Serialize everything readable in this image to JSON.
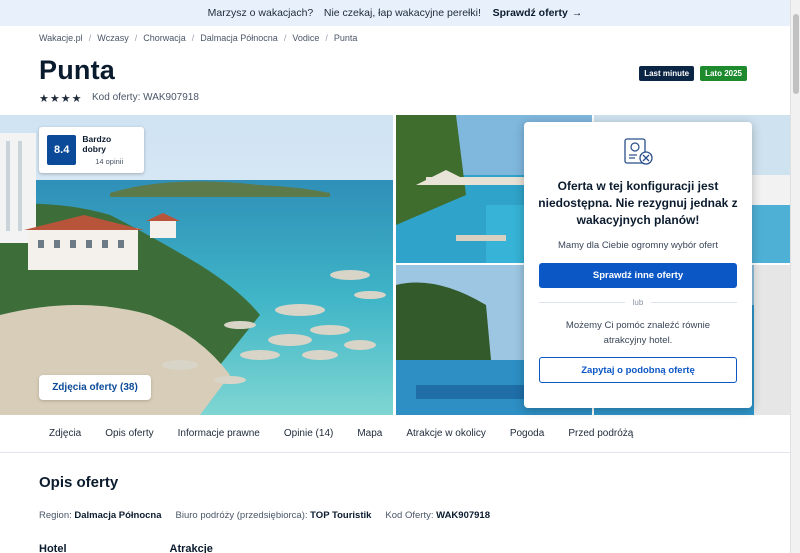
{
  "promo": {
    "text": "Marzysz o wakacjach?⠀ Nie czekaj, łap wakacyjne perełki!⠀",
    "cta": "Sprawdź oferty",
    "arrow": "→"
  },
  "breadcrumbs": [
    "Wakacje.pl",
    "Wczasy",
    "Chorwacja",
    "Dalmacja Północna",
    "Vodice",
    "Punta"
  ],
  "breadcrumb_sep": "/",
  "hotel": {
    "name": "Punta",
    "stars": 4,
    "code_label": "Kod oferty: WAK907918"
  },
  "badges": {
    "last_minute": "Last minute",
    "season": "Lato 2025"
  },
  "rating": {
    "score": "8.4",
    "label": "Bardzo dobry",
    "count": "14 opinii"
  },
  "gallery": {
    "photos_button": "Zdjęcia oferty (38)"
  },
  "modal": {
    "title": "Oferta w tej konfiguracji jest niedostępna. Nie rezygnuj jednak z wakacyjnych planów!",
    "subtitle": "Mamy dla Ciebie ogromny wybór ofert",
    "primary_button": "Sprawdź inne oferty",
    "or_label": "lub",
    "help_text": "Możemy Ci pomóc znaleźć równie atrakcyjny hotel.",
    "secondary_button": "Zapytaj o podobną ofertę"
  },
  "tabs": [
    "Zdjęcia",
    "Opis oferty",
    "Informacje prawne",
    "Opinie (14)",
    "Mapa",
    "Atrakcje w okolicy",
    "Pogoda",
    "Przed podróżą"
  ],
  "offer": {
    "section_title": "Opis oferty",
    "region_label": "Region:",
    "region_value": "Dalmacja Północna",
    "operator_label": "Biuro podróży (przedsiębiorca):",
    "operator_value": "TOP Touristik",
    "code_label": "Kod Oferty:",
    "code_value": "WAK907918",
    "col_hotel": "Hotel",
    "col_attractions": "Atrakcje"
  },
  "colors": {
    "brand_blue": "#0b57c5",
    "last_minute_bg": "#0b2545",
    "season_bg": "#1d8a2e",
    "rating_bg": "#0b4a99"
  }
}
